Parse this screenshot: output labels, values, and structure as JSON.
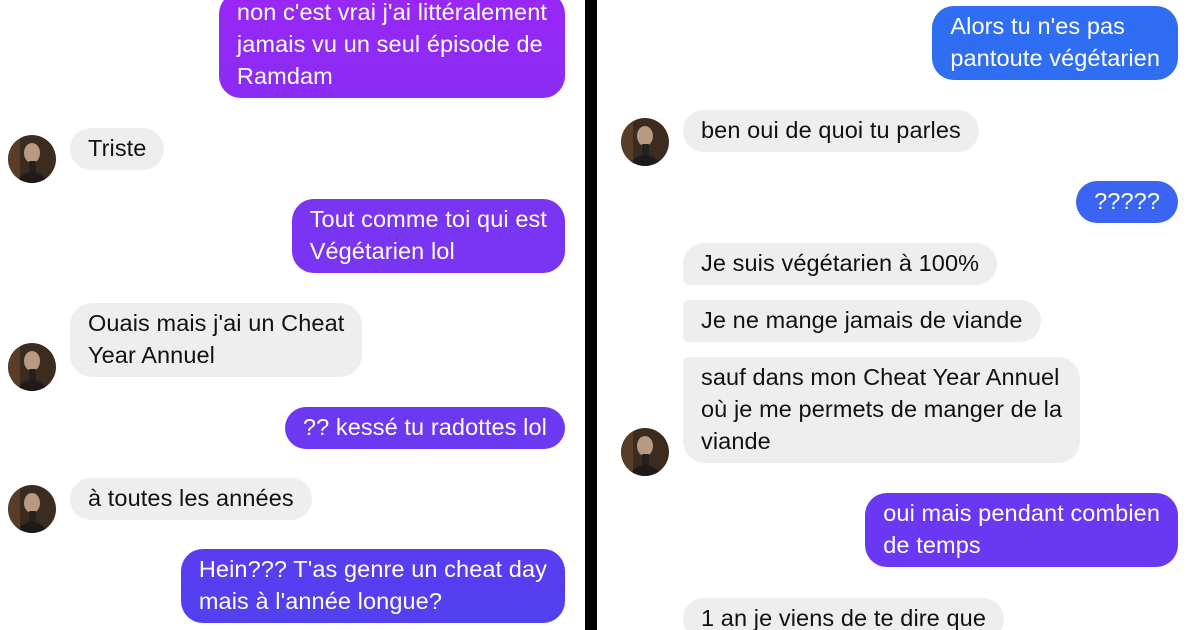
{
  "left_conversation": {
    "messages": [
      {
        "id": "l1",
        "sender": "me",
        "text": "non c'est vrai j'ai littéralement\njamais vu un seul épisode de\nRamdam"
      },
      {
        "id": "l2",
        "sender": "them",
        "text": "Triste"
      },
      {
        "id": "l3",
        "sender": "me",
        "text": "Tout comme toi qui est\nVégétarien lol"
      },
      {
        "id": "l4",
        "sender": "them",
        "text": "Ouais mais j'ai un Cheat\nYear Annuel"
      },
      {
        "id": "l5",
        "sender": "me",
        "text": "?? kessé tu radottes lol"
      },
      {
        "id": "l6",
        "sender": "them",
        "text": "à toutes les années"
      },
      {
        "id": "l7",
        "sender": "me",
        "text": "Hein??? T'as genre un cheat day\nmais à l'année longue?"
      }
    ]
  },
  "right_conversation": {
    "messages": [
      {
        "id": "r1",
        "sender": "me",
        "text": "Alors tu n'es pas\npantoute végétarien"
      },
      {
        "id": "r2",
        "sender": "them",
        "text": "ben oui de quoi tu parles"
      },
      {
        "id": "r3",
        "sender": "me",
        "text": "?????"
      },
      {
        "id": "r4",
        "sender": "them",
        "text": "Je suis végétarien à 100%"
      },
      {
        "id": "r5",
        "sender": "them",
        "text": "Je ne mange jamais de viande"
      },
      {
        "id": "r6",
        "sender": "them",
        "text": "sauf dans mon Cheat Year Annuel\noù je me permets de manger de la\nviande"
      },
      {
        "id": "r7",
        "sender": "me",
        "text": "oui mais pendant combien\nde temps"
      },
      {
        "id": "r8",
        "sender": "them",
        "text": "1 an je viens de te dire que"
      }
    ]
  },
  "colors": {
    "incoming_bubble": "#eeeeef",
    "incoming_text": "#111111",
    "outgoing_text": "#ffffff",
    "gradient_purple": "#8a2cf4",
    "gradient_violet": "#5e3bf0",
    "gradient_blue": "#2f6df2",
    "divider": "#000000"
  },
  "icons": {
    "avatar": "contact-avatar-photo"
  }
}
